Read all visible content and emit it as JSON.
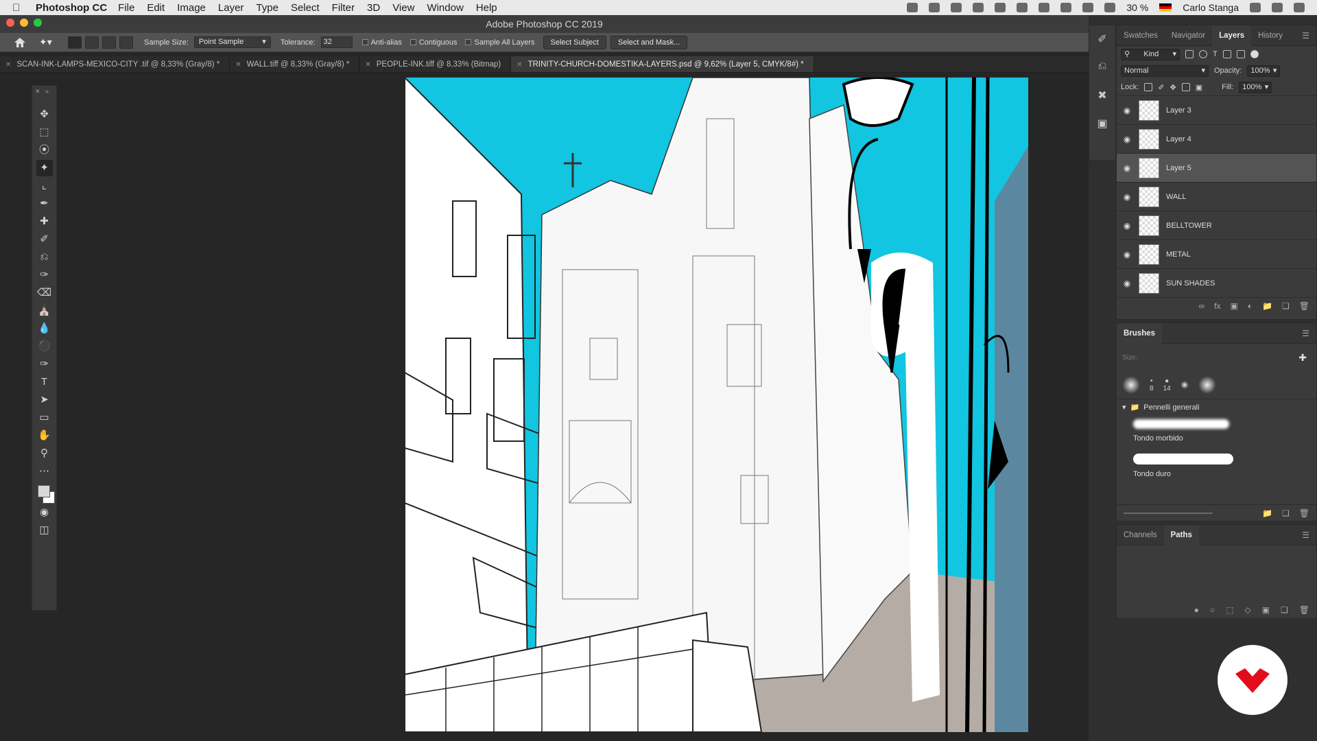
{
  "menubar": {
    "app": "Photoshop CC",
    "items": [
      "File",
      "Edit",
      "Image",
      "Layer",
      "Type",
      "Select",
      "Filter",
      "3D",
      "View",
      "Window",
      "Help"
    ],
    "battery": "30 %",
    "user": "Carlo Stanga"
  },
  "window": {
    "title": "Adobe Photoshop CC 2019"
  },
  "options": {
    "sample_size_label": "Sample Size:",
    "sample_size_value": "Point Sample",
    "tolerance_label": "Tolerance:",
    "tolerance_value": "32",
    "anti_alias": "Anti-alias",
    "contiguous": "Contiguous",
    "sample_all_layers": "Sample All Layers",
    "select_subject": "Select Subject",
    "select_and_mask": "Select and Mask..."
  },
  "tabs": [
    "SCAN-INK-LAMPS-MEXICO-CITY .tif @ 8,33% (Gray/8) *",
    "WALL.tiff @ 8,33% (Gray/8) *",
    "PEOPLE-INK.tiff @ 8,33% (Bitmap)",
    "TRINITY-CHURCH-DOMESTIKA-LAYERS.psd @ 9,62% (Layer 5, CMYK/8#) *"
  ],
  "layers_panel": {
    "tabs": [
      "Swatches",
      "Navigator",
      "Layers",
      "History"
    ],
    "filter": "Kind",
    "blend": "Normal",
    "opacity_label": "Opacity:",
    "opacity": "100%",
    "lock_label": "Lock:",
    "fill_label": "Fill:",
    "fill": "100%",
    "layers": [
      "Layer 3",
      "Layer 4",
      "Layer 5",
      "WALL",
      "BELLTOWER",
      "METAL",
      "SUN SHADES"
    ]
  },
  "brushes_panel": {
    "title": "Brushes",
    "size_label": "Size:",
    "presets": [
      "8",
      "14"
    ],
    "group": "Pennelli generali",
    "brushes": [
      "Tondo morbido",
      "Tondo duro"
    ]
  },
  "paths_panel": {
    "tabs": [
      "Channels",
      "Paths"
    ]
  },
  "colors": {
    "sky": "#12c5e0",
    "ground": "#b5aca5",
    "slate": "#5b88a0",
    "badge": "#e10d1a"
  }
}
